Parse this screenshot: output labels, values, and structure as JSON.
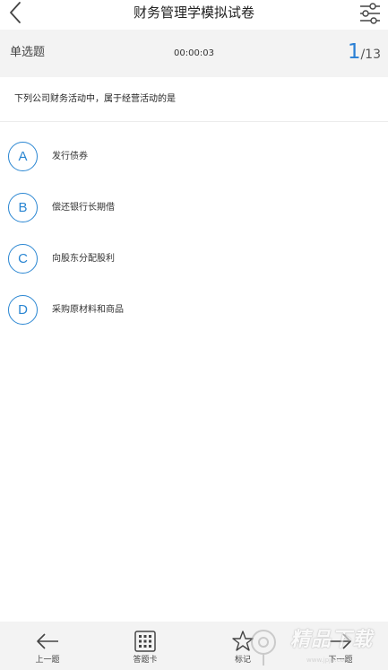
{
  "header": {
    "title": "财务管理学模拟试卷",
    "back_icon": "chevron-left-icon",
    "settings_icon": "sliders-icon"
  },
  "info": {
    "question_type": "单选题",
    "timer": "00:00:03",
    "current": "1",
    "total": "/13",
    "accent": "#2a7fd4"
  },
  "question": {
    "text": "下列公司财务活动中，属于经营活动的是"
  },
  "options": [
    {
      "letter": "A",
      "text": "发行债券"
    },
    {
      "letter": "B",
      "text": "偿还银行长期借"
    },
    {
      "letter": "C",
      "text": "向股东分配股利"
    },
    {
      "letter": "D",
      "text": "采购原材料和商品"
    }
  ],
  "bottom_bar": {
    "items": [
      {
        "label": "上一题",
        "icon": "arrow-left-icon"
      },
      {
        "label": "答题卡",
        "icon": "grid-icon"
      },
      {
        "label": "标记",
        "icon": "star-icon"
      },
      {
        "label": "下一题",
        "icon": "arrow-right-icon"
      }
    ]
  },
  "watermark": {
    "text": "精品下载",
    "url": "www.jpjb.com"
  }
}
